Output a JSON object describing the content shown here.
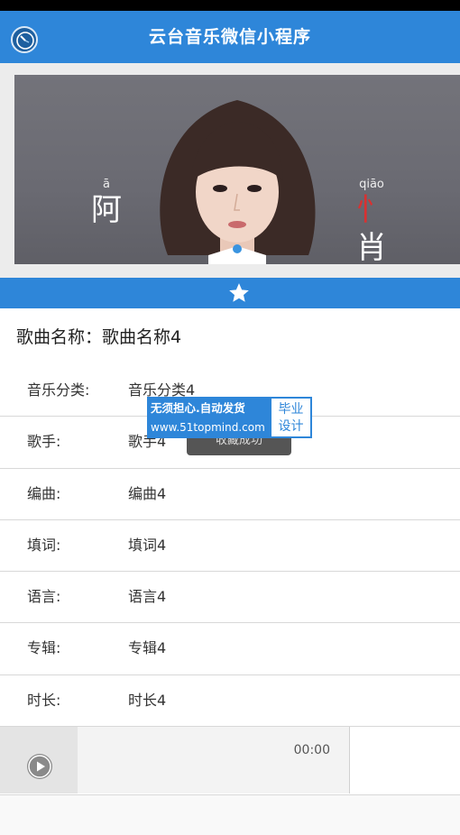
{
  "nav": {
    "title": "云台音乐微信小程序",
    "back_icon": "back-clock-icon"
  },
  "banner": {
    "caption_left_pinyin": "ā",
    "caption_left_char": "阿",
    "caption_right_pinyin": "qiāo",
    "caption_right_char_red": "忄",
    "caption_right_char_rest": "肖"
  },
  "favorite": {
    "icon": "star-icon"
  },
  "song": {
    "title": "歌曲名称：歌曲名称4"
  },
  "details": [
    {
      "label": "音乐分类:",
      "value": "音乐分类4"
    },
    {
      "label": "歌手:",
      "value": "歌手4"
    },
    {
      "label": "编曲:",
      "value": "编曲4"
    },
    {
      "label": "填词:",
      "value": "填词4"
    },
    {
      "label": "语言:",
      "value": "语言4"
    },
    {
      "label": "专辑:",
      "value": "专辑4"
    },
    {
      "label": "时长:",
      "value": "时长4"
    }
  ],
  "toast": {
    "text": "收藏成功"
  },
  "watermark": {
    "line1": "无须担心.自动发货",
    "line2": "www.51topmind.com",
    "badge_line1": "毕业",
    "badge_line2": "设计"
  },
  "player": {
    "time": "00:00",
    "play_icon": "play-icon"
  },
  "colors": {
    "primary": "#2e86d9",
    "background": "#f7f7f7"
  }
}
